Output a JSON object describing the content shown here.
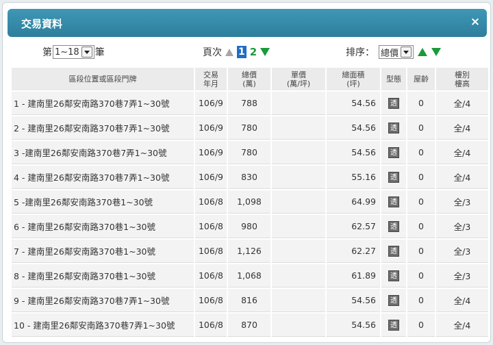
{
  "dialog": {
    "title": "交易資料",
    "close_symbol": "×"
  },
  "toolbar": {
    "range_prefix": "第",
    "range_value": "1~18",
    "range_suffix": "筆",
    "page_label": "頁次",
    "current_page": "1",
    "next_page": "2",
    "sort_label": "排序：",
    "sort_value": "總價"
  },
  "columns": {
    "address": "區段位置或區段門牌",
    "date": [
      "交易",
      "年月"
    ],
    "total": [
      "總價",
      "(萬)"
    ],
    "unit": [
      "單價",
      "(萬/坪)"
    ],
    "area": [
      "總面積",
      "(坪)"
    ],
    "type": "型態",
    "age": "屋齡",
    "floor": [
      "樓別",
      "樓高"
    ]
  },
  "rows": [
    {
      "address": "1 - 建南里26鄰安南路370巷7弄1~30號",
      "date": "106/9",
      "total": "788",
      "unit": "",
      "area": "54.56",
      "type": "透",
      "age": "0",
      "floor": "全/4"
    },
    {
      "address": "2 - 建南里26鄰安南路370巷7弄1~30號",
      "date": "106/9",
      "total": "780",
      "unit": "",
      "area": "54.56",
      "type": "透",
      "age": "0",
      "floor": "全/4"
    },
    {
      "address": "3 -建南里26鄰安南路370巷7弄1~30號",
      "date": "106/9",
      "total": "780",
      "unit": "",
      "area": "54.56",
      "type": "透",
      "age": "0",
      "floor": "全/4"
    },
    {
      "address": "4 - 建南里26鄰安南路370巷7弄1~30號",
      "date": "106/9",
      "total": "830",
      "unit": "",
      "area": "55.16",
      "type": "透",
      "age": "0",
      "floor": "全/4"
    },
    {
      "address": "5 -建南里26鄰安南路370巷1~30號",
      "date": "106/8",
      "total": "1,098",
      "unit": "",
      "area": "64.99",
      "type": "透",
      "age": "0",
      "floor": "全/3"
    },
    {
      "address": "6 - 建南里26鄰安南路370巷1~30號",
      "date": "106/8",
      "total": "980",
      "unit": "",
      "area": "62.57",
      "type": "透",
      "age": "0",
      "floor": "全/3"
    },
    {
      "address": "7 - 建南里26鄰安南路370巷1~30號",
      "date": "106/8",
      "total": "1,126",
      "unit": "",
      "area": "62.27",
      "type": "透",
      "age": "0",
      "floor": "全/3"
    },
    {
      "address": "8 - 建南里26鄰安南路370巷1~30號",
      "date": "106/8",
      "total": "1,068",
      "unit": "",
      "area": "61.89",
      "type": "透",
      "age": "0",
      "floor": "全/3"
    },
    {
      "address": "9 - 建南里26鄰安南路370巷7弄1~30號",
      "date": "106/8",
      "total": "816",
      "unit": "",
      "area": "54.56",
      "type": "透",
      "age": "0",
      "floor": "全/4"
    },
    {
      "address": "10 - 建南里26鄰安南路370巷7弄1~30號",
      "date": "106/8",
      "total": "870",
      "unit": "",
      "area": "54.56",
      "type": "透",
      "age": "0",
      "floor": "全/4"
    }
  ]
}
